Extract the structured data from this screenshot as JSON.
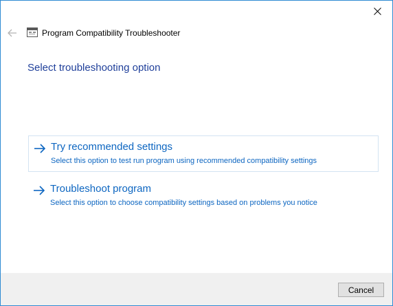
{
  "window": {
    "title": "Program Compatibility Troubleshooter",
    "accent_color": "#2d8ad3"
  },
  "titlebar": {
    "close_icon": "close-icon"
  },
  "nav": {
    "back_icon": "back-arrow-icon",
    "app_icon": "compatibility-troubleshooter-icon"
  },
  "main": {
    "heading": "Select troubleshooting option",
    "options": [
      {
        "title": "Try recommended settings",
        "description": "Select this option to test run program using recommended compatibility settings",
        "icon": "arrow-right-icon"
      },
      {
        "title": "Troubleshoot program",
        "description": "Select this option to choose compatibility settings based on problems you notice",
        "icon": "arrow-right-icon"
      }
    ],
    "link_color": "#0d66c1",
    "heading_color": "#1f3f9a"
  },
  "footer": {
    "cancel_label": "Cancel"
  }
}
